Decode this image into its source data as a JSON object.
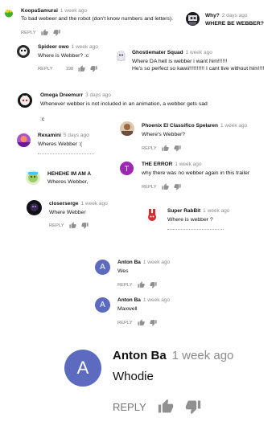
{
  "icons": {
    "like": "thumbs-up-icon",
    "dislike": "thumbs-down-icon"
  },
  "colors": {
    "anton_avatar": "#5c6bc0",
    "error_avatar": "#9c27b0",
    "text": "#111111",
    "meta": "#8a8a8a"
  },
  "comments": [
    {
      "author": "KoopaSamurai",
      "time": "1 week ago",
      "text": "To bad webeer and the robot (don't know numbers and letters).",
      "reply": "REPLY"
    },
    {
      "author": "Why?",
      "time": "2 days ago",
      "text": "WHERE BE WEBBER?"
    },
    {
      "author": "Spideer owo",
      "time": "1 week ago",
      "text": "Where is Webber? :c",
      "reply": "REPLY",
      "likes": "198"
    },
    {
      "author": "Ghostiemater Squad",
      "time": "1 week ago",
      "text": "Where DA hell is webber i want him!!!!!!",
      "text2": "He's so perfect so kawii!!!!!!!!!! I cant live without him!!!!"
    },
    {
      "author": "Omega Dreemurr",
      "time": "3 days ago",
      "text": "Whenever webber is not included in an animation, a webber gets sad",
      "text2": ":c"
    },
    {
      "author": "Rexamini",
      "time": "5 days ago",
      "text": "Wheres Webber :("
    },
    {
      "author": "Phoenix El Classifico Spelaren",
      "time": "1 week ago",
      "text": "Where's Webber?",
      "reply": "REPLY"
    },
    {
      "author": "THE ERROR",
      "time": "1 week ago",
      "text": "why there was no webber again in this trailer",
      "reply": "REPLY",
      "letter": "T"
    },
    {
      "author": "HEHEHE IM AM A",
      "text": "Wheres Webber,"
    },
    {
      "author": "closerserge",
      "time": "1 week ago",
      "text": "Where Webber",
      "reply": "REPLY"
    },
    {
      "author": "Super RabBit",
      "time": "1 week ago",
      "text": "Where is webber ?"
    },
    {
      "author": "Anton Ba",
      "time": "1 week ago",
      "text": "Wes",
      "reply": "REPLY",
      "letter": "A"
    },
    {
      "author": "Anton Ba",
      "time": "1 week ago",
      "text": "Maxwell",
      "reply": "REPLY",
      "letter": "A"
    },
    {
      "author": "Anton Ba",
      "time": "1 week ago",
      "text": "Whodie",
      "reply": "REPLY",
      "letter": "A"
    }
  ]
}
